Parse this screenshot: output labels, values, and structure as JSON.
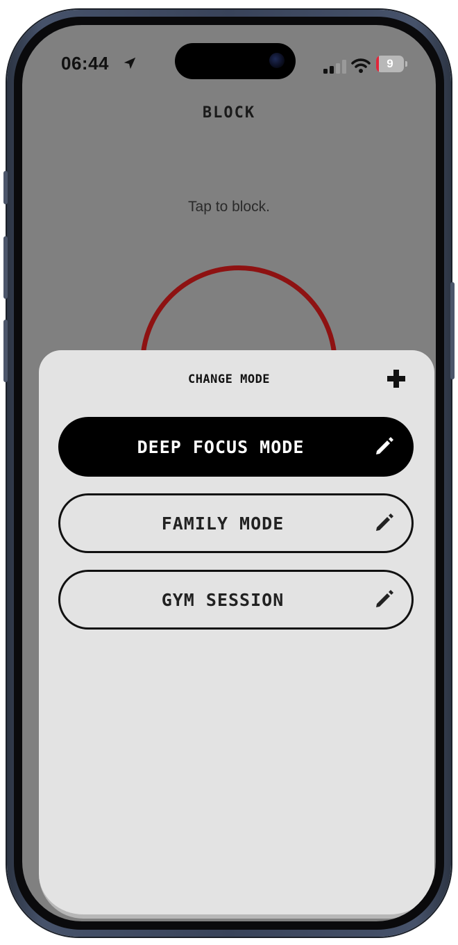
{
  "status_bar": {
    "time": "06:44",
    "battery_level": "9",
    "battery_fraction": 0.09,
    "icons": [
      "location-arrow-icon",
      "cellular-signal-icon",
      "wifi-icon",
      "battery-icon"
    ]
  },
  "page": {
    "title": "BLOCK",
    "hint": "Tap to block."
  },
  "sheet": {
    "title": "CHANGE MODE",
    "add_icon": "plus-icon",
    "modes": [
      {
        "label": "DEEP FOCUS MODE",
        "active": true,
        "edit_icon": "pencil-icon"
      },
      {
        "label": "FAMILY MODE",
        "active": false,
        "edit_icon": "pencil-icon"
      },
      {
        "label": "GYM SESSION",
        "active": false,
        "edit_icon": "pencil-icon"
      }
    ]
  },
  "colors": {
    "backdrop": "#808080",
    "sheet": "#e3e3e3",
    "active_mode": "#000000",
    "ring": "#8e1212",
    "battery_low": "#e0263a"
  }
}
